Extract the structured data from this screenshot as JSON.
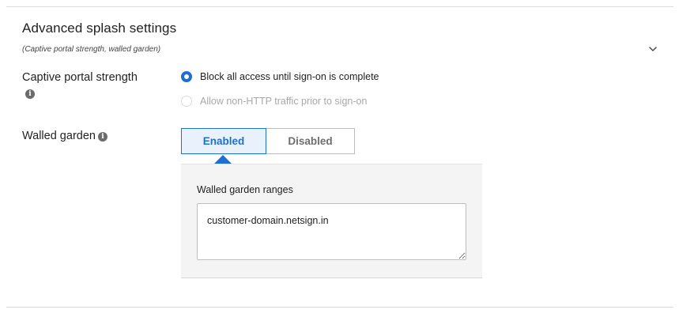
{
  "section": {
    "title": "Advanced splash settings",
    "subtitle": "(Captive portal strength, walled garden)",
    "collapse_icon": "chevron-down-icon"
  },
  "captive_portal": {
    "label": "Captive portal strength",
    "info_icon": "i",
    "options": [
      {
        "label": "Block all access until sign-on is complete",
        "selected": true,
        "disabled": false
      },
      {
        "label": "Allow non-HTTP traffic prior to sign-on",
        "selected": false,
        "disabled": true
      }
    ]
  },
  "walled_garden": {
    "label": "Walled garden",
    "info_icon": "i",
    "toggle": {
      "enabled_label": "Enabled",
      "disabled_label": "Disabled",
      "selected": "Enabled"
    },
    "ranges": {
      "label": "Walled garden ranges",
      "value": "customer-domain.netsign.in"
    }
  },
  "colors": {
    "accent": "#1f6fd1",
    "accent_bg": "#e9f1fc",
    "panel_bg": "#f4f4f4",
    "disabled_text": "#a8a8a8"
  }
}
